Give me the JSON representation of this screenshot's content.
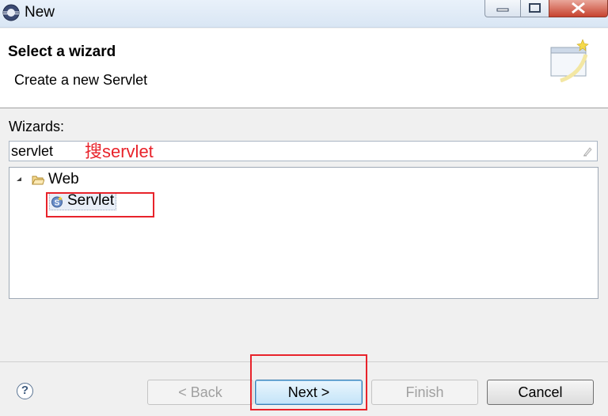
{
  "window": {
    "title": "New",
    "icon": "eclipse-icon"
  },
  "header": {
    "title": "Select a wizard",
    "subtitle": "Create a new Servlet",
    "image": "wizard-banner-icon"
  },
  "wizards": {
    "label": "Wizards:",
    "filter_value": "servlet"
  },
  "annotation": {
    "text": "搜servlet",
    "color": "#e8232b"
  },
  "tree": {
    "nodes": [
      {
        "label": "Web",
        "expanded": true,
        "icon": "folder-icon",
        "children": [
          {
            "label": "Servlet",
            "selected": true,
            "icon": "servlet-icon"
          }
        ]
      }
    ]
  },
  "buttons": {
    "back": "< Back",
    "next": "Next >",
    "finish": "Finish",
    "cancel": "Cancel"
  },
  "colors": {
    "annotation_red": "#e8232b",
    "default_button_border": "#3c7fb1"
  }
}
